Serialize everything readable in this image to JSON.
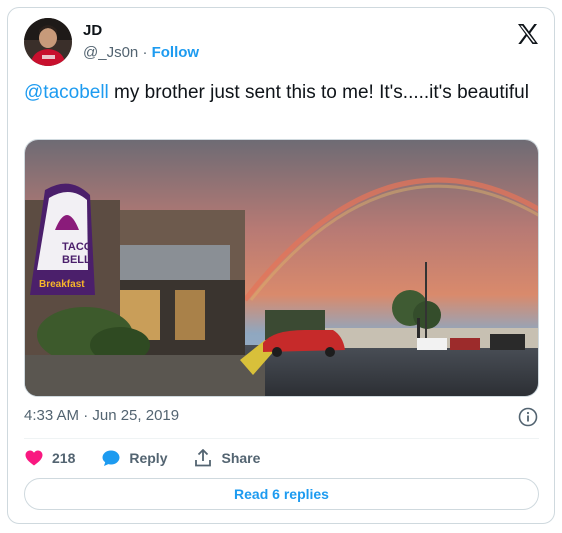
{
  "author": {
    "name": "JD",
    "handle": "@_Js0n",
    "separator": "·",
    "follow_label": "Follow"
  },
  "tweet": {
    "mention": "@tacobell",
    "text": " my brother just sent this to me! It's.....it's beautiful",
    "timestamp": "4:33 AM · Jun 25, 2019"
  },
  "media": {
    "sign_line1": "TACO",
    "sign_line2": "BELL",
    "sign_banner": "Breakfast"
  },
  "actions": {
    "like_count": "218",
    "reply_label": "Reply",
    "share_label": "Share"
  },
  "read_replies_label": "Read 6 replies",
  "colors": {
    "accent": "#1d9bf0",
    "like": "#f91880",
    "muted": "#536471"
  }
}
